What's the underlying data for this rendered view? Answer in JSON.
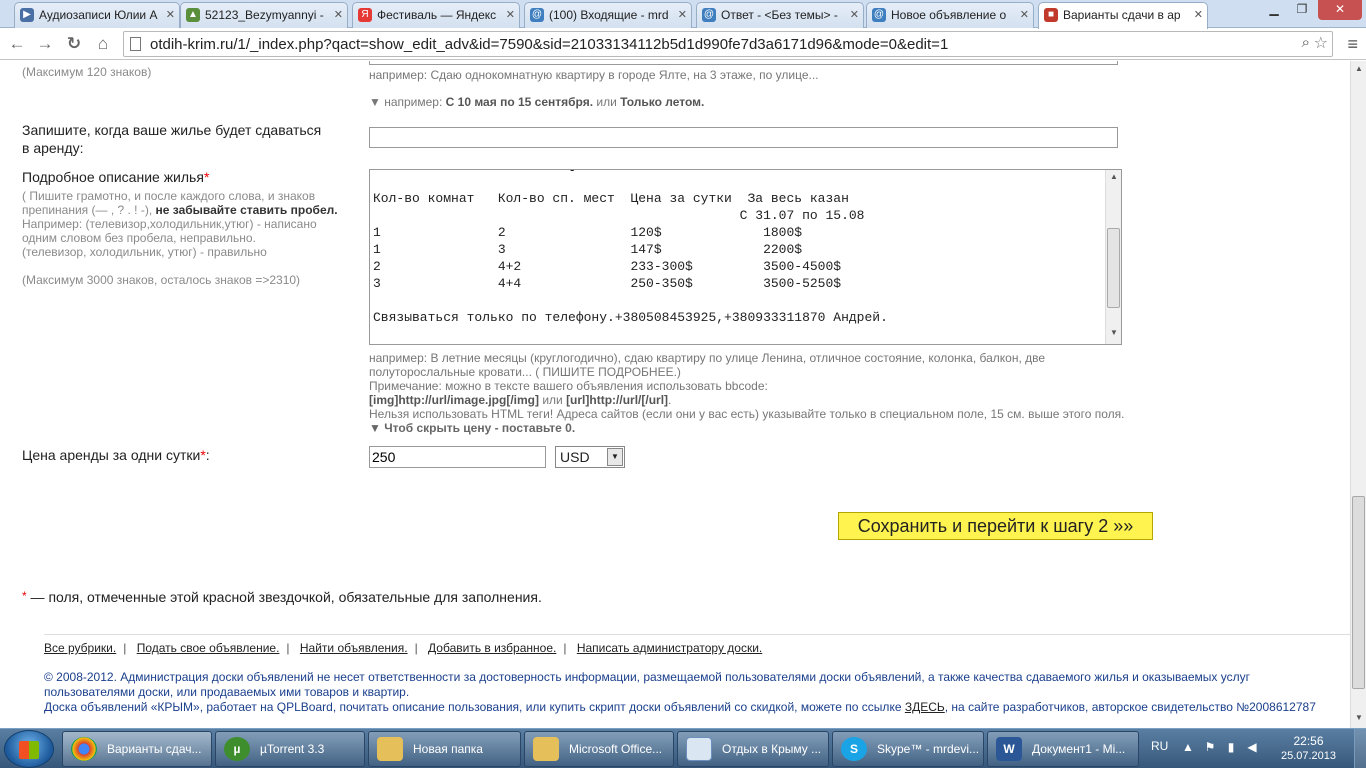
{
  "browser": {
    "tabs": [
      {
        "title": "Аудиозаписи Юлии А",
        "icon": "play-icon",
        "color": "#4a6fa5"
      },
      {
        "title": "52123_Bezymyannyi -",
        "icon": "photo-icon",
        "color": "#5a8f3c"
      },
      {
        "title": "Фестиваль — Яндекс",
        "icon": "yandex-icon",
        "color": "#e53935"
      },
      {
        "title": "(100) Входящие - mrd",
        "icon": "mail-icon",
        "color": "#3f7fbf"
      },
      {
        "title": "Ответ - <Без темы> -",
        "icon": "mail-icon",
        "color": "#3f7fbf"
      },
      {
        "title": "Новое объявление о",
        "icon": "mail-icon",
        "color": "#3f7fbf"
      },
      {
        "title": "Варианты сдачи в ар",
        "icon": "cube-icon",
        "color": "#c0392b",
        "active": true
      }
    ],
    "url": "otdih-krim.ru/1/_index.php?qact=show_edit_adv&id=7590&sid=21033134112b5d1d990fe7d3a6171d96&mode=0&edit=1"
  },
  "form": {
    "max120": "(Максимум 120 знаков)",
    "title_example": "например: Сдаю однокомнатную квартиру в городе Ялте, на 3 этаже, по улице...",
    "when_example_prefix": "▼ например: ",
    "when_example_b1": "С 10 мая по 15 сентября.",
    "when_example_mid": " или ",
    "when_example_b2": "Только летом.",
    "when_label_line1": "Запишите, когда ваше жилье будет сдаваться",
    "when_label_line2": "в аренду:",
    "when_value": "",
    "desc_label": "Подробное описание жилья",
    "req_mark": "*",
    "desc_hint_line1": "( Пишите грамотно, и после каждого слова, и знаков",
    "desc_hint_line2a": "препинания (— , ? . ! -), ",
    "desc_hint_line2b": "не забывайте ставить пробел.",
    "desc_hint_line3": "Например: (телевизор,холодильник,утюг) - написано",
    "desc_hint_line4": "одним словом без пробела, неправильно.",
    "desc_hint_line5": "(телевизор,   холодильник,   утюг) - правильно",
    "desc_max": "(Максимум 3000 знаков, осталось знаков =>2310)",
    "desc_text": "Кол-во комнат   Кол-во сп. мест  Цена за сутки  За весь казан\n                                               С 31.07 по 15.08\n1               2                120$             1800$\n1               3                147$             2200$\n2               4+2              233-300$         3500-4500$\n3               4+4              250-350$         3500-5250$\n\nСвязываться только по телефону.+380508453925,+380933311870 Андрей.",
    "desc_example_line1": "например: В летние месяцы (круглогодично), сдаю квартиру по улице Ленина, отличное состояние, колонка, балкон, две",
    "desc_example_line2": "полуторослальные кровати... ( ПИШИТЕ ПОДРОБНЕЕ.)",
    "bbcode_note": "Примечание: можно в тексте вашего объявления использовать bbcode:",
    "bbcode_img": "[img]http://url/image.jpg[/img]",
    "bbcode_or": " или ",
    "bbcode_url": "[url]http://url/[/url]",
    "bbcode_dot": ".",
    "html_warning": "Нельзя использовать HTML теги! Адреса сайтов (если они у вас есть) указывайте только в специальном поле, 15 см. выше этого поля.",
    "hide_price": "▼ Чтоб скрыть цену - поставьте 0.",
    "price_label": "Цена аренды за одни сутки",
    "price_colon": ":",
    "price_value": "250",
    "currency": "USD",
    "submit": "Сохранить и перейти к шагу 2 »»",
    "required_note": " — поля, отмеченные этой красной звездочкой, обязательные для заполнения."
  },
  "footer": {
    "links": [
      "Все рубрики.",
      "Подать свое объявление.",
      "Найти объявления.",
      "Добавить в избранное.",
      "Написать администратору доски."
    ],
    "sep": "|",
    "copyright_line1": "© 2008-2012. Администрация доски объявлений не несет ответственности за достоверность информации, размещаемой пользователями доски объявлений, а также качества сдаваемого жилья и оказываемых услуг пользователями доски, или продаваемых ими товаров и квартир.",
    "board_line_a": "Доска объявлений «КРЫМ», работает на QPLBoard, почитать описание пользования, или купить скрипт доски объявлений со скидкой, можете по ссылке ",
    "board_link": "ЗДЕСЬ",
    "board_line_b": ", на сайте разработчиков, авторское свидетельство №2008612787"
  },
  "taskbar": {
    "items": [
      {
        "label": "Варианты сдач...",
        "icon": "chrome-icon",
        "color": "#d9412f",
        "active": true
      },
      {
        "label": "µTorrent 3.3",
        "icon": "utorrent-icon",
        "color": "#3e8e2e"
      },
      {
        "label": "Новая папка",
        "icon": "folder-icon",
        "color": "#e5c05a"
      },
      {
        "label": "Microsoft Office...",
        "icon": "folder-icon",
        "color": "#e5c05a"
      },
      {
        "label": "Отдых в Крыму ...",
        "icon": "document-icon",
        "color": "#6c8fbf"
      },
      {
        "label": "Skype™ - mrdevi...",
        "icon": "skype-icon",
        "color": "#1aa4e5"
      },
      {
        "label": "Документ1 - Mi...",
        "icon": "word-icon",
        "color": "#2b5797"
      }
    ],
    "lang": "RU",
    "time": "22:56",
    "date": "25.07.2013"
  }
}
